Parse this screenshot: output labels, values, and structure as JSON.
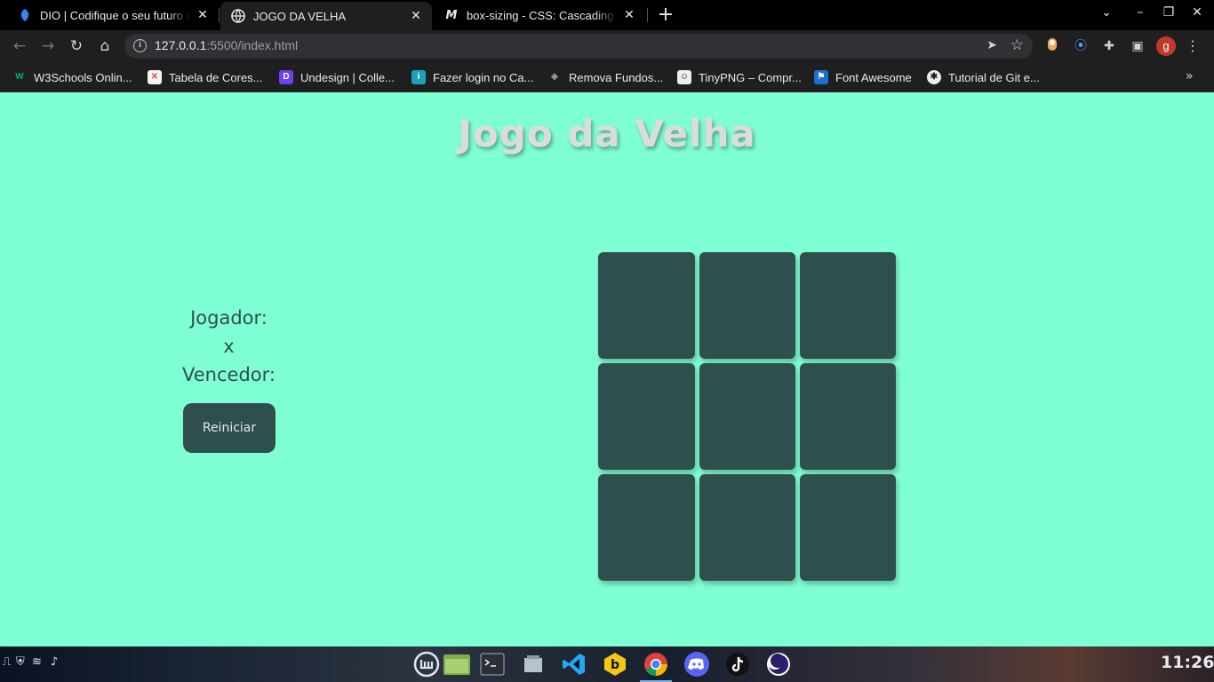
{
  "browser": {
    "tabs": [
      {
        "title": "DIO | Codifique o seu futuro g",
        "icon": "dio-icon"
      },
      {
        "title": "JOGO DA VELHA",
        "icon": "globe-icon",
        "active": true
      },
      {
        "title": "box-sizing - CSS: Cascading St",
        "icon": "mdn-icon"
      }
    ],
    "close_glyph": "✕",
    "new_tab_glyph": "+",
    "url": {
      "host": "127.0.0.1",
      "rest": ":5500/index.html"
    },
    "profile_initial": "g",
    "bookmarks": [
      {
        "label": "W3Schools Onlin...",
        "icon": "w3schools-icon",
        "color": "#04aa6d",
        "glyph": "W"
      },
      {
        "label": "Tabela de Cores...",
        "icon": "colors-icon",
        "color": "#e84c3d",
        "glyph": "✕"
      },
      {
        "label": "Undesign | Colle...",
        "icon": "undesign-icon",
        "color": "#6c3ff0",
        "glyph": "D"
      },
      {
        "label": "Fazer login no Ca...",
        "icon": "canva-icon",
        "color": "#1aa3b8",
        "glyph": "i"
      },
      {
        "label": "Remova Fundos...",
        "icon": "removebg-icon",
        "color": "#8a8f98",
        "glyph": "◆"
      },
      {
        "label": "TinyPNG – Compr...",
        "icon": "tinypng-icon",
        "color": "#444",
        "glyph": "☺"
      },
      {
        "label": "Font Awesome",
        "icon": "fontawesome-icon",
        "color": "#1c6ed3",
        "glyph": "⚑"
      },
      {
        "label": "Tutorial de Git e...",
        "icon": "git-icon",
        "color": "#222",
        "glyph": "✱"
      }
    ]
  },
  "page": {
    "title": "Jogo da Velha",
    "player_label": "Jogador:",
    "player_value": "x",
    "winner_label": "Vencedor:",
    "restart_label": "Reiniciar",
    "board": [
      "",
      "",
      "",
      "",
      "",
      "",
      "",
      "",
      ""
    ],
    "colors": {
      "background": "#7fffd4",
      "cell": "#2f4f4f",
      "text": "#2f4f4f"
    }
  },
  "taskbar": {
    "clock": "11:26",
    "apps": [
      "mint-menu-icon",
      "files-icon",
      "terminal-icon",
      "workspace-icon",
      "vscode-icon",
      "bitwarden-icon",
      "chrome-icon",
      "discord-icon",
      "tiktok-icon",
      "moon-app-icon"
    ]
  }
}
